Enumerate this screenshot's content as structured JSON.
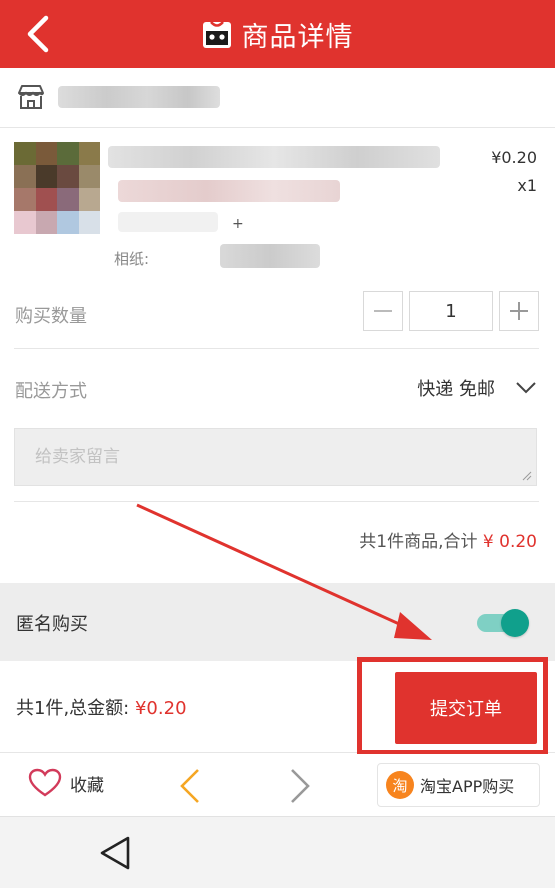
{
  "header": {
    "title": "商品详情",
    "color": "#e0332e"
  },
  "shop": {
    "icon": "store-icon"
  },
  "item": {
    "price": "¥0.20",
    "quantity_label": "x1",
    "spec_label": "相纸:"
  },
  "quantity": {
    "label": "购买数量",
    "value": "1"
  },
  "delivery": {
    "label": "配送方式",
    "value": "快递 免邮"
  },
  "message": {
    "placeholder": "给卖家留言"
  },
  "subtotal": {
    "prefix": "共1件商品,合计",
    "amount": "¥ 0.20"
  },
  "anonymous": {
    "label": "匿名购买",
    "enabled": true
  },
  "total": {
    "prefix": "共1件,总金额:",
    "amount": "¥0.20"
  },
  "submit": {
    "label": "提交订单"
  },
  "bottom_nav": {
    "favorite_label": "收藏",
    "app_label": "淘宝APP购买",
    "app_badge": "淘"
  }
}
